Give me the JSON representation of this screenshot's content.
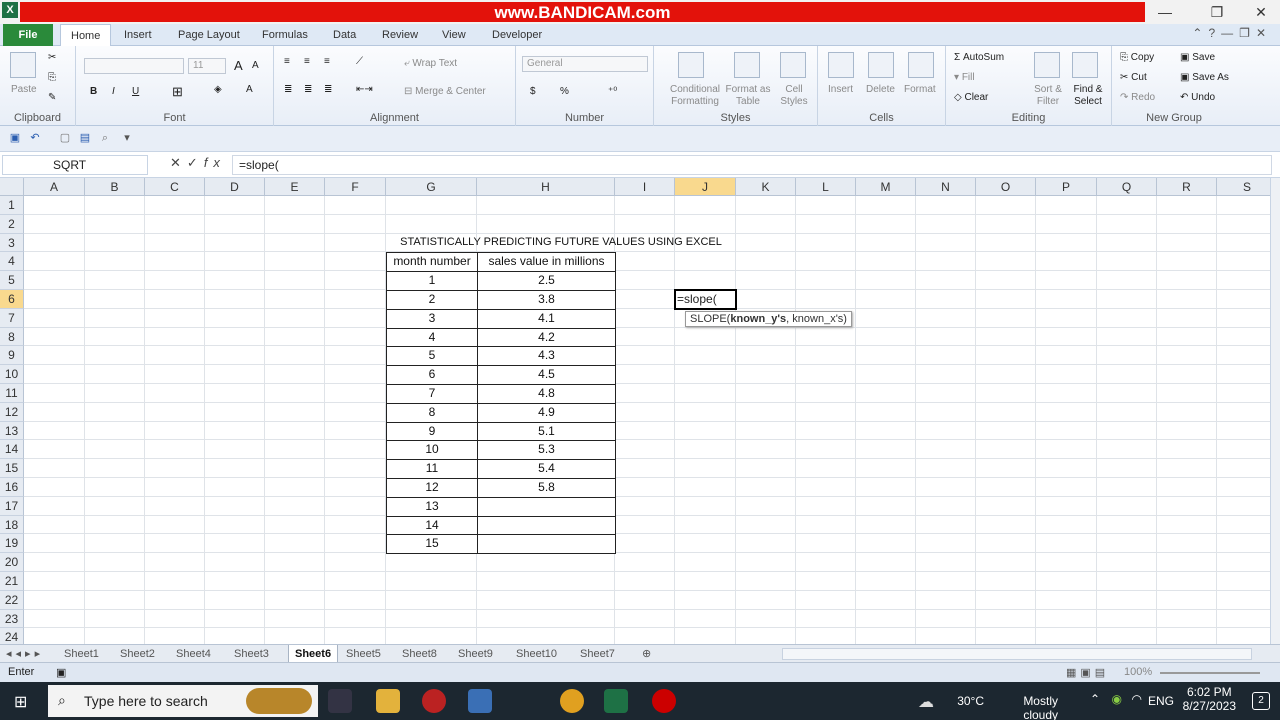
{
  "window": {
    "app_icon": "X",
    "banner": "www.BANDICAM.com",
    "minimize": "—",
    "restore": "❐",
    "close": "✕"
  },
  "ribbon_tabs": {
    "file": "File",
    "items": [
      "Home",
      "Insert",
      "Page Layout",
      "Formulas",
      "Data",
      "Review",
      "View",
      "Developer"
    ]
  },
  "ribbon": {
    "clipboard": {
      "label": "Clipboard",
      "paste": "Paste"
    },
    "font": {
      "label": "Font",
      "size": "11",
      "bold": "B",
      "italic": "I",
      "underline": "U"
    },
    "alignment": {
      "label": "Alignment",
      "wrap_text": "Wrap Text",
      "merge_center": "Merge & Center"
    },
    "number": {
      "label": "Number",
      "format": "General",
      "currency": "$",
      "percent": "%"
    },
    "styles": {
      "label": "Styles",
      "conditional": "Conditional Formatting",
      "format_table": "Format as Table",
      "cell_styles": "Cell Styles"
    },
    "cells": {
      "label": "Cells",
      "insert": "Insert",
      "delete": "Delete",
      "format": "Format"
    },
    "editing": {
      "label": "Editing",
      "autosum": "AutoSum",
      "fill": "Fill",
      "clear": "Clear",
      "sort": "Sort & Filter",
      "find": "Find & Select"
    },
    "new_group": {
      "label": "New Group",
      "copy": "Copy",
      "save": "Save",
      "cut": "Cut",
      "save_as": "Save As",
      "redo": "Redo",
      "undo": "Undo"
    }
  },
  "formula_bar": {
    "name_box": "SQRT",
    "formula": "=slope("
  },
  "columns": [
    "A",
    "B",
    "C",
    "D",
    "E",
    "F",
    "G",
    "H",
    "I",
    "J",
    "K",
    "L",
    "M",
    "N",
    "O",
    "P",
    "Q",
    "R",
    "S"
  ],
  "rows": [
    "1",
    "2",
    "3",
    "4",
    "5",
    "6",
    "7",
    "8",
    "9",
    "10",
    "11",
    "12",
    "13",
    "14",
    "15",
    "16",
    "17",
    "18",
    "19",
    "20",
    "21",
    "22",
    "23",
    "24"
  ],
  "selected_column": "J",
  "selected_row": "6",
  "sheet": {
    "title": "STATISTICALLY PREDICTING FUTURE VALUES USING EXCEL",
    "headers": [
      "month number",
      "sales value in millions"
    ],
    "rows": [
      [
        "1",
        "2.5"
      ],
      [
        "2",
        "3.8"
      ],
      [
        "3",
        "4.1"
      ],
      [
        "4",
        "4.2"
      ],
      [
        "5",
        "4.3"
      ],
      [
        "6",
        "4.5"
      ],
      [
        "7",
        "4.8"
      ],
      [
        "8",
        "4.9"
      ],
      [
        "9",
        "5.1"
      ],
      [
        "10",
        "5.3"
      ],
      [
        "11",
        "5.4"
      ],
      [
        "12",
        "5.8"
      ],
      [
        "13",
        ""
      ],
      [
        "14",
        ""
      ],
      [
        "15",
        ""
      ]
    ],
    "active_cell_text": "=slope(",
    "tooltip_fn": "SLOPE(",
    "tooltip_arg1": "known_y's",
    "tooltip_rest": ", known_x's)"
  },
  "sheet_tabs": [
    "Sheet1",
    "Sheet2",
    "Sheet4",
    "Sheet3",
    "Sheet6",
    "Sheet5",
    "Sheet8",
    "Sheet9",
    "Sheet10",
    "Sheet7"
  ],
  "active_sheet": "Sheet6",
  "status": {
    "mode": "Enter",
    "zoom": "100%"
  },
  "taskbar": {
    "search_placeholder": "Type here to search",
    "weather_temp": "30°C",
    "weather_desc": "Mostly cloudy",
    "lang": "ENG",
    "time": "6:02 PM",
    "date": "8/27/2023",
    "notif_count": "2"
  }
}
